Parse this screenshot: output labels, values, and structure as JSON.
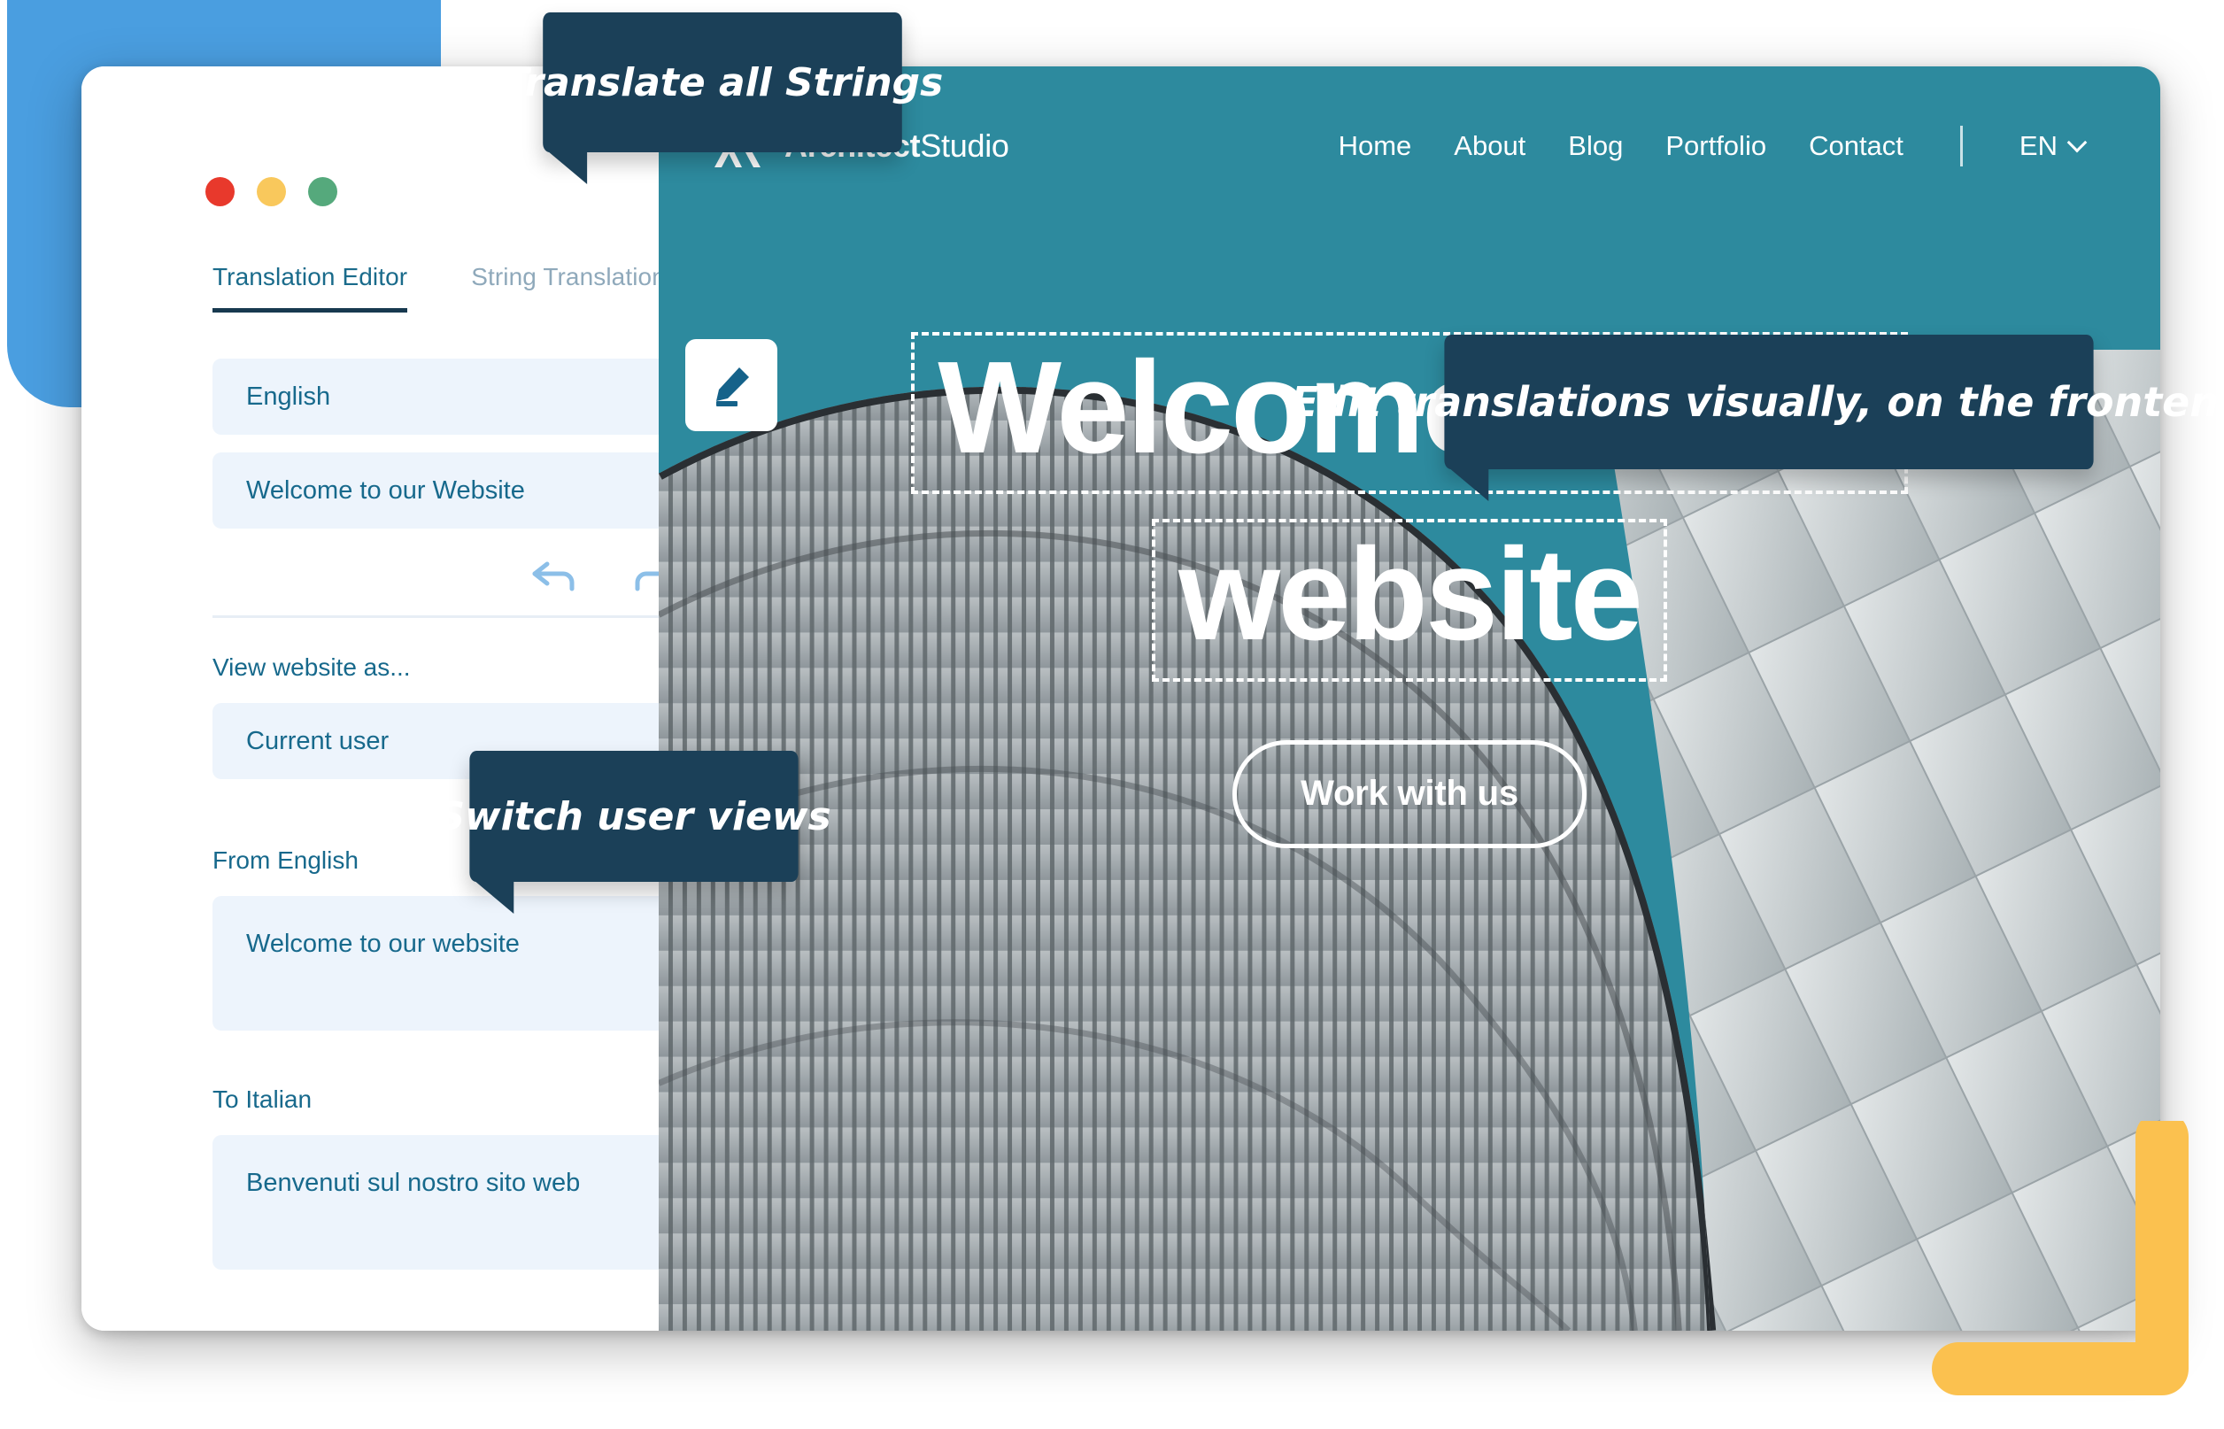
{
  "decor": {
    "blue_shape_color": "#4a9ee0",
    "yellow_shape_color": "#fbc14f"
  },
  "window": {
    "traffic_lights": [
      {
        "name": "close",
        "color": "#e8392c"
      },
      {
        "name": "minimize",
        "color": "#f9c85c"
      },
      {
        "name": "maximize",
        "color": "#55a97c"
      }
    ]
  },
  "sidebar": {
    "tabs": [
      {
        "label": "Translation Editor",
        "active": true
      },
      {
        "label": "String Translation",
        "active": false
      }
    ],
    "language_select": {
      "value": "English",
      "icon": "chevron-down-icon"
    },
    "string_select": {
      "value": "Welcome to our Website",
      "icon": "chevron-down-icon"
    },
    "history": {
      "undo_icon": "undo-arrow-icon",
      "redo_icon": "redo-arrow-icon"
    },
    "view_as": {
      "label": "View website as...",
      "value": "Current user",
      "icon": "chevron-down-icon"
    },
    "source": {
      "label": "From English",
      "value": "Welcome to our website"
    },
    "target": {
      "label": "To Italian",
      "value": "Benvenuti sul nostro sito web",
      "flag": "italian-flag-icon"
    }
  },
  "site": {
    "brand": {
      "logo_icon": "architect-a-logo-icon",
      "name_bold": "Architect",
      "name_light": "Studio"
    },
    "nav": [
      {
        "label": "Home"
      },
      {
        "label": "About"
      },
      {
        "label": "Blog"
      },
      {
        "label": "Portfolio"
      },
      {
        "label": "Contact"
      }
    ],
    "language_switcher": {
      "label": "EN",
      "icon": "chevron-down-icon"
    },
    "hero": {
      "edit_icon": "pencil-edit-icon",
      "line1": "Welcome to our",
      "line2": "website",
      "cta_label": "Work with us"
    },
    "background_color": "#2d8a9e"
  },
  "callouts": {
    "translate": "Translate all Strings",
    "edit": "Edit translations visually, on the frontend",
    "switch": "Switch user views"
  }
}
